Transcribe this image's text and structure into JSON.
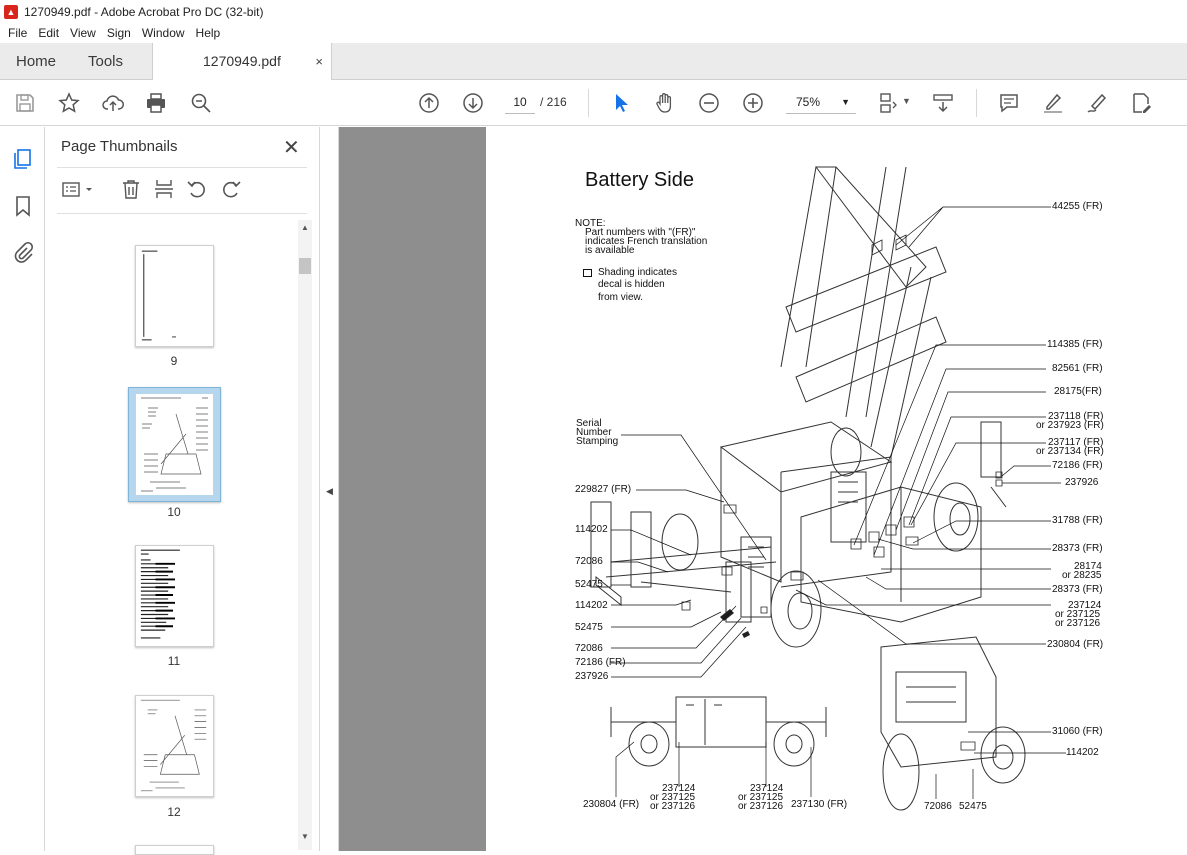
{
  "window": {
    "title": "1270949.pdf - Adobe Acrobat Pro DC (32-bit)"
  },
  "menu": [
    "File",
    "Edit",
    "View",
    "Sign",
    "Window",
    "Help"
  ],
  "tabs": {
    "home": "Home",
    "tools": "Tools",
    "document": "1270949.pdf",
    "close": "×"
  },
  "toolbar": {
    "page_current": "10",
    "page_total": "/ 216",
    "zoom": "75%"
  },
  "panel": {
    "title": "Page Thumbnails",
    "close": "✕",
    "thumbs": [
      {
        "label": "9"
      },
      {
        "label": "10"
      },
      {
        "label": "11"
      },
      {
        "label": "12"
      }
    ]
  },
  "colors": {
    "selected_thumb": "#b5d6ec",
    "viewer_bg": "#8e8e8e",
    "accent": "#1473e6"
  },
  "doc": {
    "title": "Battery Side",
    "note": [
      "NOTE:",
      "Part numbers with \"(FR)\"",
      "indicates French translation",
      "is available"
    ],
    "shading": [
      "Shading indicates",
      "decal is hidden",
      "from view."
    ],
    "serial": [
      "Serial",
      "Number",
      "Stamping"
    ],
    "right_labels": [
      "44255 (FR)",
      "114385 (FR)",
      "82561 (FR)",
      "28175(FR)",
      "237118 (FR)",
      "or 237923 (FR)",
      "237117 (FR)",
      "or 237134 (FR)",
      "72186 (FR)",
      "237926",
      "31788 (FR)",
      "28373 (FR)",
      "28174",
      "or 28235",
      "28373 (FR)",
      "237124",
      "or 237125",
      "or 237126",
      "230804 (FR)",
      "31060 (FR)",
      "114202"
    ],
    "left_labels": [
      "229827 (FR)",
      "114202",
      "72086",
      "52475",
      "114202",
      "52475",
      "72086",
      "72186 (FR)",
      "237926"
    ],
    "bottom_labels": [
      "237124",
      "or 237125",
      "or 237126",
      "230804 (FR)",
      "237124",
      "or 237125",
      "or 237126",
      "237130 (FR)",
      "72086",
      "52475"
    ]
  }
}
